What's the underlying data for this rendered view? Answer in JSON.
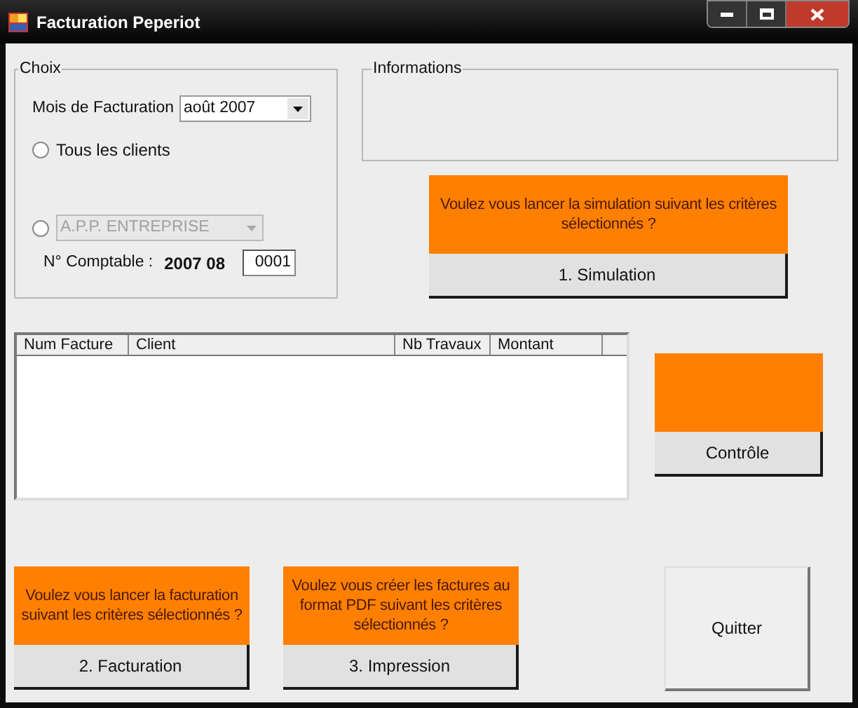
{
  "window": {
    "title": "Facturation Peperiot"
  },
  "choix": {
    "title": "Choix",
    "month_label": "Mois de Facturation",
    "month_value": "août 2007",
    "options": [
      {
        "kind": "label",
        "label": "Tous les clients",
        "selected": false
      },
      {
        "kind": "combo",
        "value": "A.P.P. ENTREPRISE",
        "selected": false,
        "disabled": true
      }
    ],
    "account_label": "N° Comptable :",
    "account_prefix": "2007 08",
    "account_number": "0001"
  },
  "informations": {
    "title": "Informations"
  },
  "simulation": {
    "prompt": "Voulez vous lancer la simulation suivant les critères sélectionnés ?",
    "button": "1. Simulation"
  },
  "table": {
    "columns": [
      "Num Facture",
      "Client",
      "Nb Travaux",
      "Montant"
    ]
  },
  "controle": {
    "button": "Contrôle"
  },
  "facturation": {
    "prompt": "Voulez vous lancer la facturation suivant les critères sélectionnés ?",
    "button": "2. Facturation"
  },
  "impression": {
    "prompt": "Voulez vous créer les factures au format PDF suivant les critères sélectionnés ?",
    "button": "3. Impression"
  },
  "quit": {
    "button": "Quitter"
  }
}
